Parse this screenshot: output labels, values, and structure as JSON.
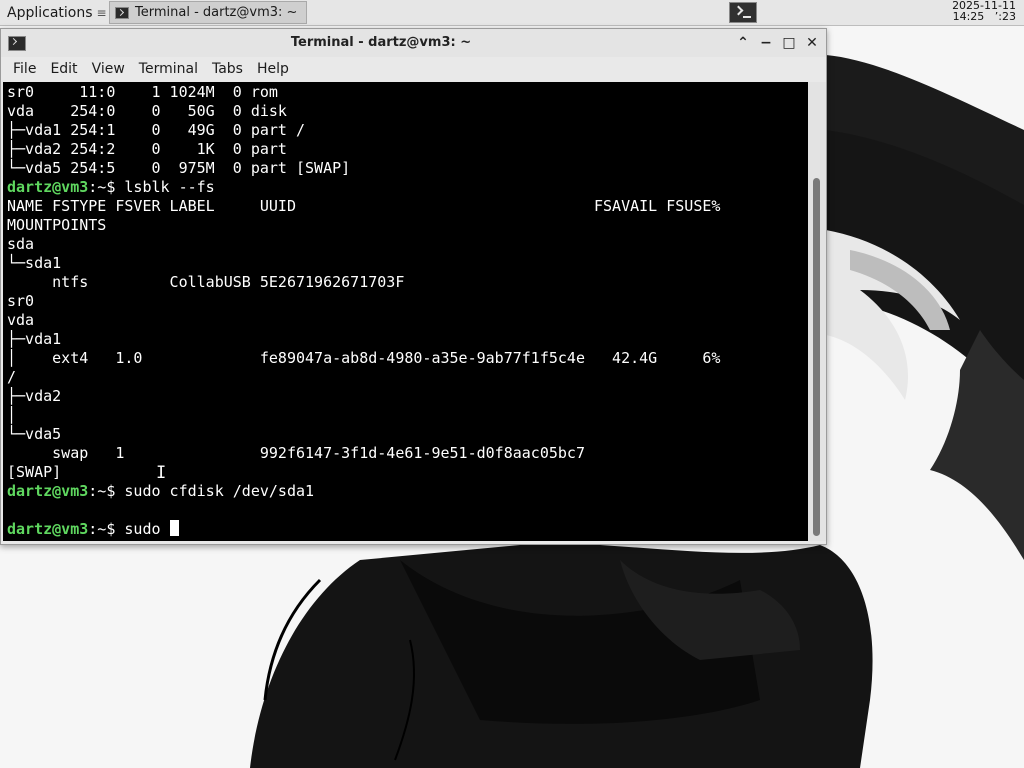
{
  "panel": {
    "applications_label": "Applications",
    "applications_sep": "≡",
    "task_button_label": "Terminal - dartz@vm3: ~",
    "clock_date": "2025-11-11",
    "clock_time_a": "14:25",
    "clock_time_b": "ʼ:23"
  },
  "window": {
    "title": "Terminal - dartz@vm3: ~",
    "up_icon": "⌃",
    "min_icon": "−",
    "max_icon": "□",
    "close_icon": "✕"
  },
  "menu": [
    "File",
    "Edit",
    "View",
    "Terminal",
    "Tabs",
    "Help"
  ],
  "terminal": {
    "user_host": "dartz@vm3",
    "lines": [
      "sr0     11:0    1 1024M  0 rom",
      "vda    254:0    0   50G  0 disk",
      "├─vda1 254:1    0   49G  0 part /",
      "├─vda2 254:2    0    1K  0 part",
      "└─vda5 254:5    0  975M  0 part [SWAP]",
      "NAME FSTYPE FSVER LABEL     UUID                                 FSAVAIL FSUSE%",
      "MOUNTPOINTS",
      "sda",
      "└─sda1",
      "     ntfs         CollabUSB 5E2671962671703F",
      "sr0",
      "vda",
      "├─vda1",
      "│    ext4   1.0             fe89047a-ab8d-4980-a35e-9ab77f1f5c4e   42.4G     6%",
      "/",
      "├─vda2",
      "│",
      "└─vda5",
      "     swap   1               992f6147-3f1d-4e61-9e51-d0f8aac05bc7",
      "[SWAP]",
      "",
      ""
    ],
    "commands": {
      "cmd1": "lsblk --fs",
      "cmd2": "sudo cfdisk /dev/sda1",
      "cmd3": "sudo "
    },
    "prompt_suffix": ":~$ "
  },
  "colors": {
    "prompt_green": "#5fd75f",
    "terminal_bg": "#000000"
  }
}
